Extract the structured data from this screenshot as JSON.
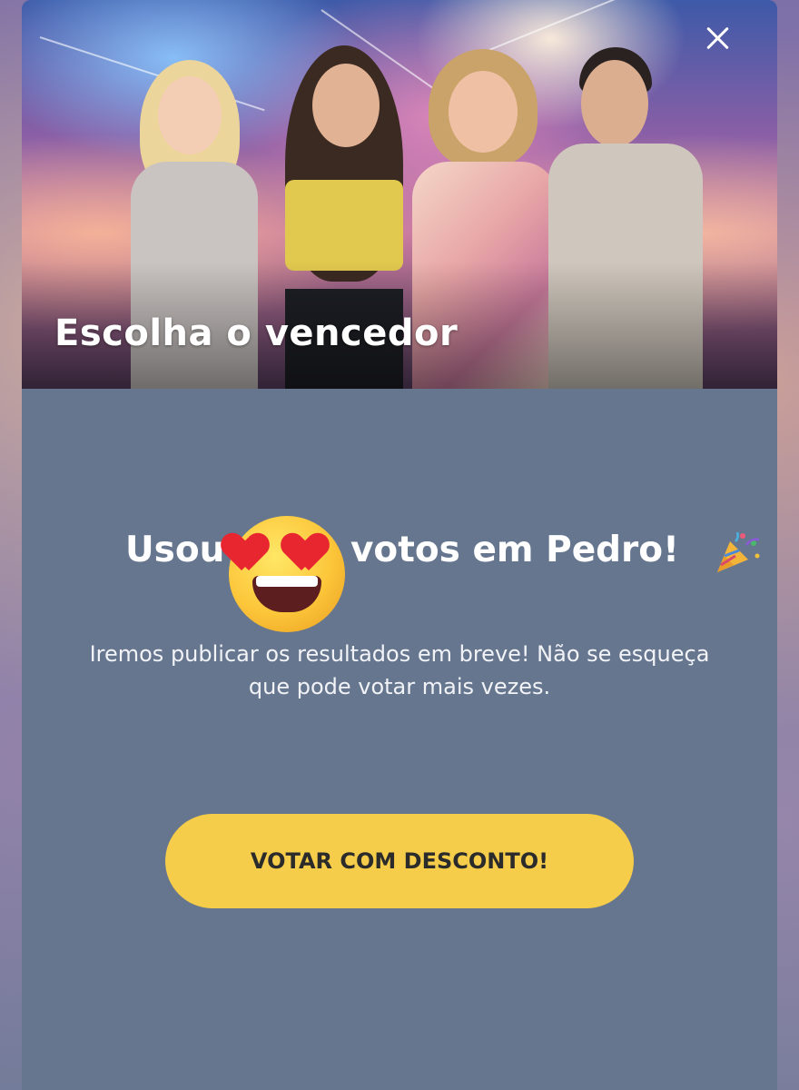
{
  "hero": {
    "title": "Escolha o vencedor"
  },
  "close_icon": "close-icon",
  "result": {
    "headline_before": "Usou",
    "emoji": "heart-eyes-emoji",
    "headline_after": "votos em Pedro!",
    "celebration_icon": "party-popper-icon",
    "message": "Iremos publicar os resultados em breve! Não se esqueça que pode votar mais vezes."
  },
  "cta": {
    "label": "VOTAR COM DESCONTO!"
  },
  "colors": {
    "cta_background": "#f5cd4a",
    "panel_background": "#66768f",
    "text": "#ffffff"
  }
}
